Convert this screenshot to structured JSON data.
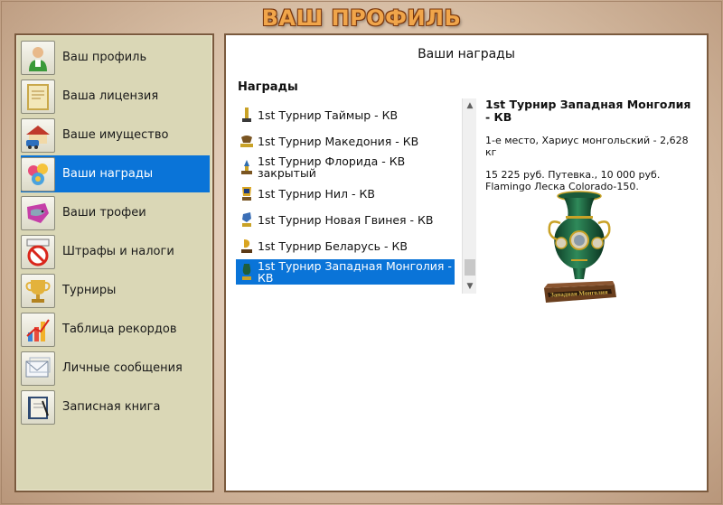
{
  "page": {
    "title": "ВАШ ПРОФИЛЬ"
  },
  "sidebar": {
    "items": [
      {
        "label": "Ваш профиль",
        "icon": "user-icon"
      },
      {
        "label": "Ваша лицензия",
        "icon": "license-icon"
      },
      {
        "label": "Ваше имущество",
        "icon": "property-icon"
      },
      {
        "label": "Ваши награды",
        "icon": "awards-icon"
      },
      {
        "label": "Ваши трофеи",
        "icon": "fish-trophy-icon"
      },
      {
        "label": "Штрафы и налоги",
        "icon": "fines-icon"
      },
      {
        "label": "Турниры",
        "icon": "cup-icon"
      },
      {
        "label": "Таблица рекордов",
        "icon": "records-chart-icon"
      },
      {
        "label": "Личные сообщения",
        "icon": "messages-icon"
      },
      {
        "label": "Записная книга",
        "icon": "notebook-icon"
      }
    ],
    "active_index": 3
  },
  "main": {
    "title": "Ваши награды",
    "section_heading": "Награды",
    "awards": [
      {
        "label": "1st Турнир Таймыр - КВ",
        "icon": "trophy-icon"
      },
      {
        "label": "1st Турнир Македония - КВ",
        "icon": "trophy-icon"
      },
      {
        "label": "1st Турнир Флорида - КВ закрытый",
        "icon": "trophy-icon"
      },
      {
        "label": "1st Турнир Нил - КВ",
        "icon": "trophy-icon"
      },
      {
        "label": "1st Турнир Новая Гвинея - КВ",
        "icon": "trophy-icon"
      },
      {
        "label": "1st Турнир Беларусь - КВ",
        "icon": "trophy-icon"
      },
      {
        "label": "1st Турнир Западная Монголия - КВ",
        "icon": "trophy-icon"
      }
    ],
    "selected_index": 6,
    "detail": {
      "title": "1st Турнир Западная Монголия - КВ",
      "place": "1-е место, Хариус монгольский - 2,628 кг",
      "prize": "15 225 руб. Путевка., 10 000 руб. Flamingo Леска Colorado-150.",
      "vase_caption": "Западная Монголия"
    }
  },
  "colors": {
    "selection": "#0a74d8",
    "sidebar_bg": "#dad7b6",
    "title": "#f0a54a"
  }
}
